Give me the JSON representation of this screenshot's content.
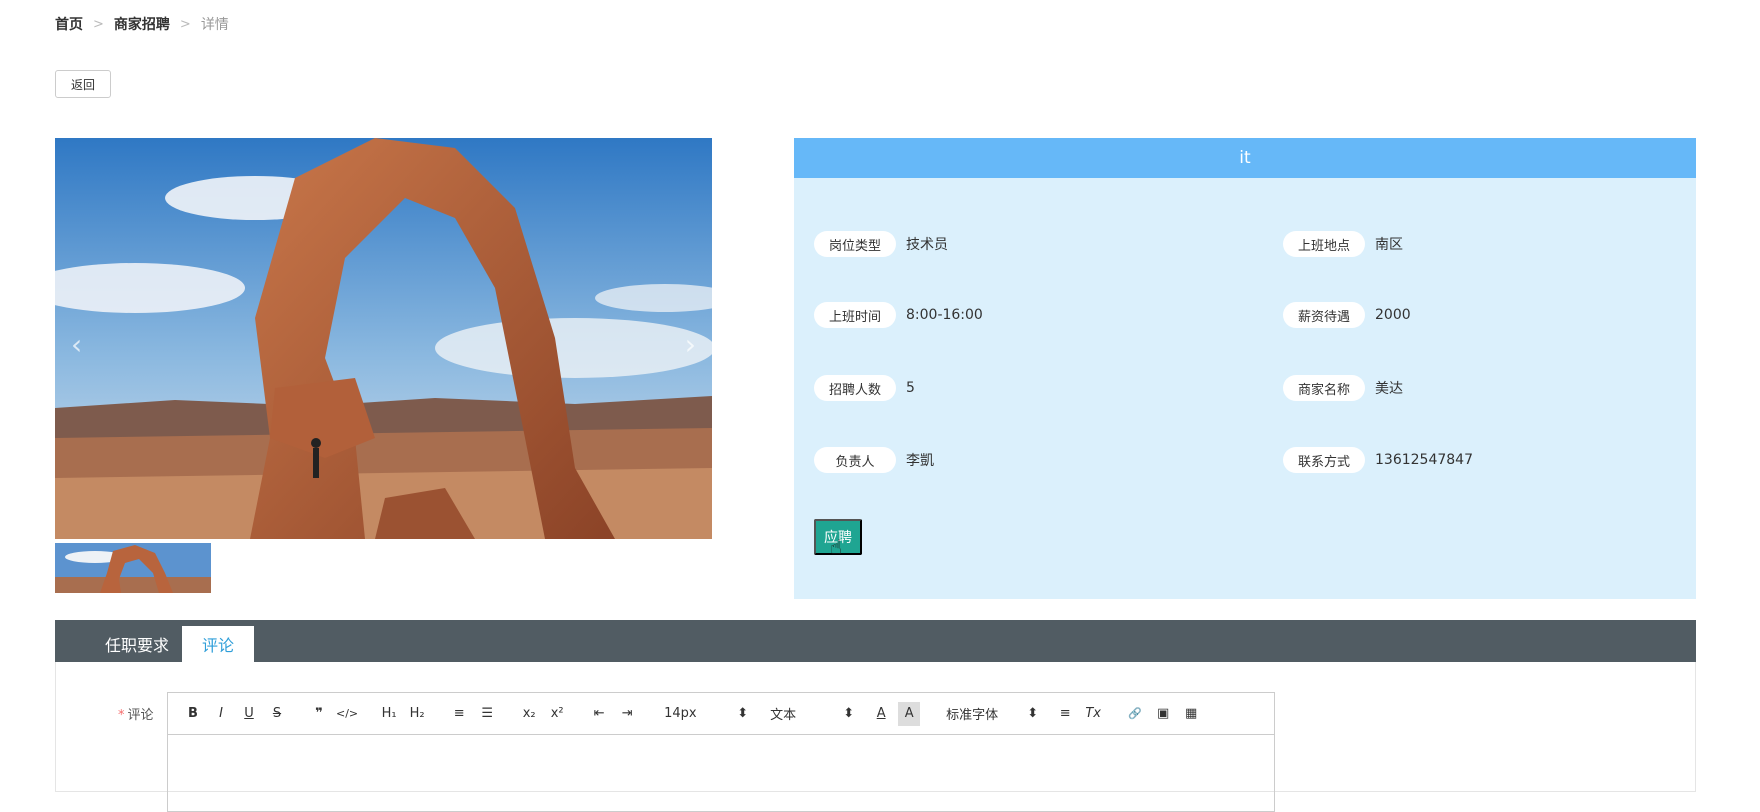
{
  "breadcrumb": {
    "home": "首页",
    "list": "商家招聘",
    "current": "详情",
    "separator": ">"
  },
  "back_button": "返回",
  "gallery": {
    "prev_icon": "chevron-left-icon",
    "next_icon": "chevron-right-icon",
    "prev_glyph": "‹",
    "next_glyph": "›"
  },
  "info": {
    "title": "it",
    "fields": [
      {
        "label": "岗位类型",
        "value": "技术员"
      },
      {
        "label": "上班地点",
        "value": "南区"
      },
      {
        "label": "上班时间",
        "value": "8:00-16:00"
      },
      {
        "label": "薪资待遇",
        "value": "2000"
      },
      {
        "label": "招聘人数",
        "value": "5"
      },
      {
        "label": "商家名称",
        "value": "美达"
      },
      {
        "label": "负责人",
        "value": "李凱"
      },
      {
        "label": "联系方式",
        "value": "13612547847"
      }
    ],
    "apply_button": "应聘",
    "header_color": "#66b8f8",
    "background_color": "#dbf0fc",
    "button_color": "#1fa592"
  },
  "tabs": [
    {
      "label": "任职要求",
      "active": false
    },
    {
      "label": "评论",
      "active": true
    }
  ],
  "comment_form": {
    "required_mark": "*",
    "label": "评论",
    "toolbar": {
      "bold": "B",
      "italic": "I",
      "underline": "U",
      "strike": "S",
      "blockquote": "❞",
      "code": "</>",
      "h1": "H₁",
      "h2": "H₂",
      "ordered_list": "≡",
      "bullet_list": "☰",
      "subscript": "x₂",
      "superscript": "x²",
      "outdent": "⇤",
      "indent": "⇥",
      "size_value": "14px",
      "header_value": "文本",
      "font_color": "A",
      "background_color": "A",
      "font_value": "标准字体",
      "align": "≡",
      "clean": "Tx",
      "link": "🔗",
      "image": "▣",
      "video": "▦",
      "select_caret": "⬍"
    }
  }
}
